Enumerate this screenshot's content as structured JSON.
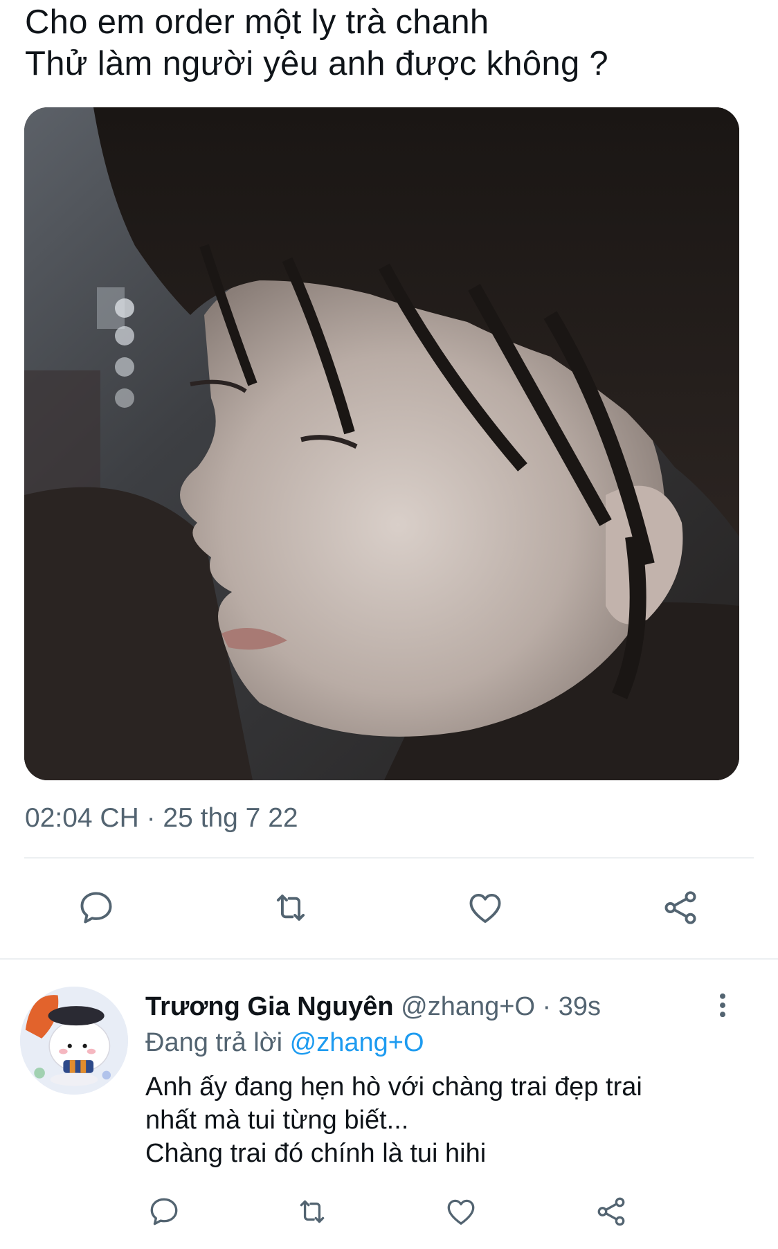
{
  "tweet": {
    "line1": "Cho em order một ly trà chanh",
    "line2": "Thử làm người yêu anh được không ?",
    "timestamp": "02:04 CH · 25 thg 7 22"
  },
  "actions": {
    "reply_icon": "reply-bubble-icon",
    "retweet_icon": "retweet-icon",
    "like_icon": "heart-icon",
    "share_icon": "share-icon"
  },
  "reply": {
    "name": "Trương Gia Nguyên",
    "meta": " @zhang+O · 39s",
    "replying_prefix": "Đang trả lời ",
    "replying_handle": "@zhang+O",
    "body_line1": "Anh ấy đang hẹn hò với chàng trai đẹp trai",
    "body_line2": "nhất mà tui từng biết...",
    "body_line3": "Chàng trai đó chính là tui hihi"
  },
  "colors": {
    "text_primary": "#0f1419",
    "text_secondary": "#536471",
    "link": "#1d9bf0",
    "icon": "#536471",
    "divider": "#eceff1"
  }
}
